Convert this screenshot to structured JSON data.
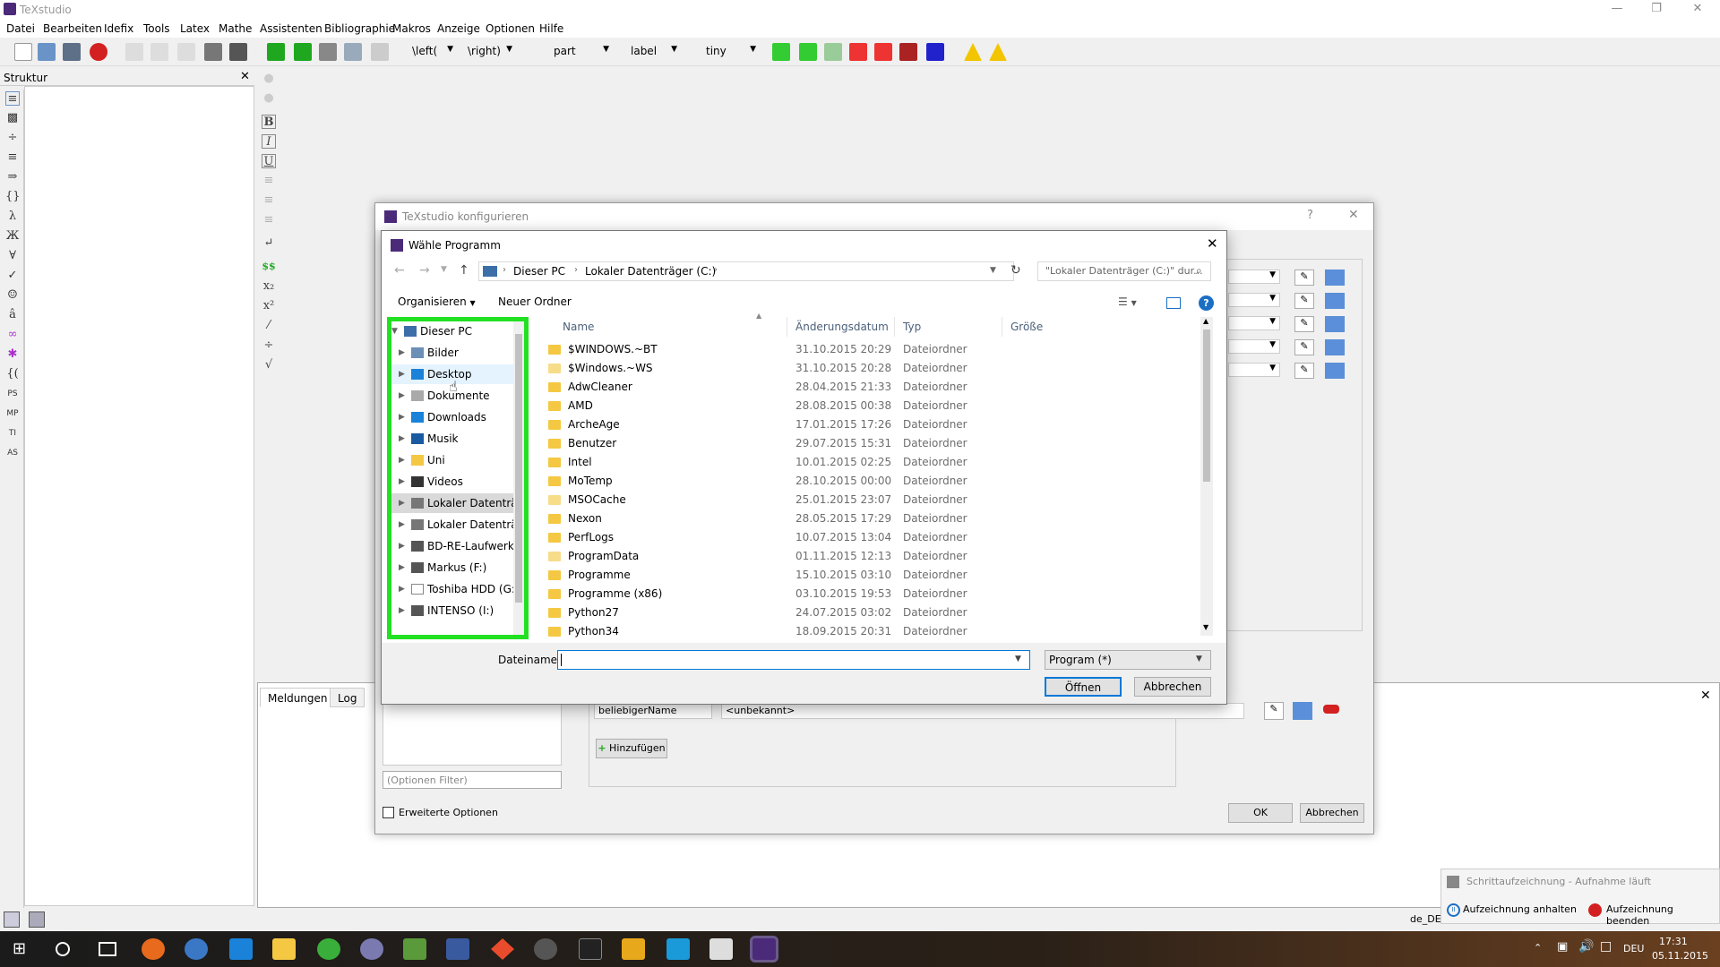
{
  "window": {
    "title": "TeXstudio"
  },
  "menu": [
    "Datei",
    "Bearbeiten",
    "Idefix",
    "Tools",
    "Latex",
    "Mathe",
    "Assistenten",
    "Bibliographie",
    "Makros",
    "Anzeige",
    "Optionen",
    "Hilfe"
  ],
  "toolbar": {
    "left_delim": "\\left(",
    "right_delim": "\\right)",
    "section": "part",
    "label": "label",
    "size": "tiny"
  },
  "structure": {
    "header": "Struktur"
  },
  "bottom": {
    "tabs": [
      "Meldungen",
      "Log"
    ]
  },
  "status": {
    "lang": "de_DE"
  },
  "config": {
    "title": "TeXstudio konfigurieren",
    "help": "?",
    "name_field": "beliebigerName",
    "cmd_field": "<unbekannt>",
    "add_button": "Hinzufügen",
    "filter_placeholder": "(Optionen Filter)",
    "advanced_options": "Erweiterte Optionen",
    "ok": "OK",
    "cancel": "Abbrechen"
  },
  "chooser": {
    "title": "Wähle Programm",
    "breadcrumb": [
      "Dieser PC",
      "Lokaler Datenträger (C:)"
    ],
    "search_placeholder": "\"Lokaler Datenträger (C:)\" dur...",
    "organize": "Organisieren",
    "new_folder": "Neuer Ordner",
    "columns": [
      "Name",
      "Änderungsdatum",
      "Typ",
      "Größe"
    ],
    "tree": [
      {
        "label": "Dieser PC",
        "icon": "computer-icon",
        "root": true
      },
      {
        "label": "Bilder",
        "icon": "pictures-icon"
      },
      {
        "label": "Desktop",
        "icon": "desktop-icon"
      },
      {
        "label": "Dokumente",
        "icon": "documents-icon"
      },
      {
        "label": "Downloads",
        "icon": "downloads-icon"
      },
      {
        "label": "Musik",
        "icon": "music-icon"
      },
      {
        "label": "Uni",
        "icon": "folder-icon"
      },
      {
        "label": "Videos",
        "icon": "videos-icon"
      },
      {
        "label": "Lokaler Datenträ",
        "icon": "drive-icon",
        "selected": true
      },
      {
        "label": "Lokaler Datenträ",
        "icon": "drive-icon"
      },
      {
        "label": "BD-RE-Laufwerk",
        "icon": "optical-drive-icon"
      },
      {
        "label": "Markus (F:)",
        "icon": "drive-icon"
      },
      {
        "label": "Toshiba HDD (G:",
        "icon": "drive-icon"
      },
      {
        "label": "INTENSO (I:)",
        "icon": "drive-icon"
      }
    ],
    "files": [
      {
        "name": "$WINDOWS.~BT",
        "date": "31.10.2015 20:29",
        "type": "Dateiordner"
      },
      {
        "name": "$Windows.~WS",
        "date": "31.10.2015 20:28",
        "type": "Dateiordner"
      },
      {
        "name": "AdwCleaner",
        "date": "28.04.2015 21:33",
        "type": "Dateiordner"
      },
      {
        "name": "AMD",
        "date": "28.08.2015 00:38",
        "type": "Dateiordner"
      },
      {
        "name": "ArcheAge",
        "date": "17.01.2015 17:26",
        "type": "Dateiordner"
      },
      {
        "name": "Benutzer",
        "date": "29.07.2015 15:31",
        "type": "Dateiordner"
      },
      {
        "name": "Intel",
        "date": "10.01.2015 02:25",
        "type": "Dateiordner"
      },
      {
        "name": "MoTemp",
        "date": "28.10.2015 00:00",
        "type": "Dateiordner"
      },
      {
        "name": "MSOCache",
        "date": "25.01.2015 23:07",
        "type": "Dateiordner"
      },
      {
        "name": "Nexon",
        "date": "28.05.2015 17:29",
        "type": "Dateiordner"
      },
      {
        "name": "PerfLogs",
        "date": "10.07.2015 13:04",
        "type": "Dateiordner"
      },
      {
        "name": "ProgramData",
        "date": "01.11.2015 12:13",
        "type": "Dateiordner"
      },
      {
        "name": "Programme",
        "date": "15.10.2015 03:10",
        "type": "Dateiordner"
      },
      {
        "name": "Programme (x86)",
        "date": "03.10.2015 19:53",
        "type": "Dateiordner"
      },
      {
        "name": "Python27",
        "date": "24.07.2015 03:02",
        "type": "Dateiordner"
      },
      {
        "name": "Python34",
        "date": "18.09.2015 20:31",
        "type": "Dateiordner"
      }
    ],
    "filename_label": "Dateiname:",
    "filename_value": "",
    "filter": "Program (*)",
    "open": "Öffnen",
    "cancel": "Abbrechen"
  },
  "notification": {
    "title": "Schrittaufzeichnung - Aufnahme läuft",
    "pause": "Aufzeichnung anhalten",
    "stop": "Aufzeichnung beenden"
  },
  "tray": {
    "lang": "DEU",
    "time": "17:31",
    "date": "05.11.2015"
  },
  "colors": {
    "highlight": "#22e022",
    "accent": "#0078d7",
    "selected_bg": "#cce8ff"
  }
}
